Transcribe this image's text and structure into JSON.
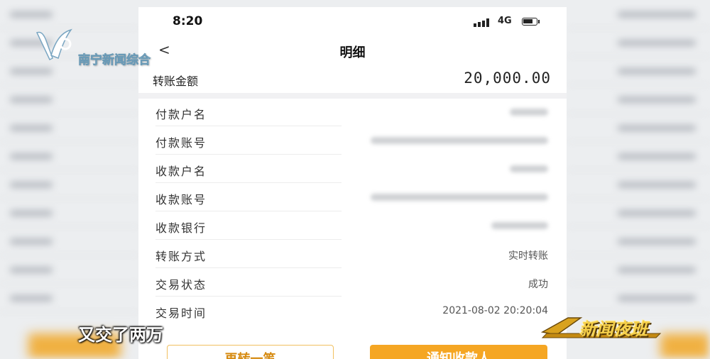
{
  "status_bar": {
    "time": "8:20",
    "network": "4G"
  },
  "nav": {
    "title": "明细"
  },
  "summary": {
    "label": "转账金额",
    "amount": "20,000.00"
  },
  "details": [
    {
      "label": "付款户名",
      "value": ""
    },
    {
      "label": "付款账号",
      "value": ""
    },
    {
      "label": "收款户名",
      "value": ""
    },
    {
      "label": "收款账号",
      "value": ""
    },
    {
      "label": "收款银行",
      "value": ""
    },
    {
      "label": "转账方式",
      "value": "实时转账"
    },
    {
      "label": "交易状态",
      "value": "成功"
    },
    {
      "label": "交易时间",
      "value": "2021-08-02 20:20:04"
    }
  ],
  "buttons": {
    "again_label": "再转一笔",
    "notify_label": "通知收款人"
  },
  "overlay": {
    "channel_name": "南宁新闻综合",
    "subtitle": "又交了两万",
    "show_name": "新闻夜班"
  },
  "colors": {
    "accent": "#f5a623",
    "accent_text": "#d68a10"
  },
  "icons": [
    "back-icon",
    "signal-icon",
    "battery-icon",
    "channel-logo-icon"
  ]
}
